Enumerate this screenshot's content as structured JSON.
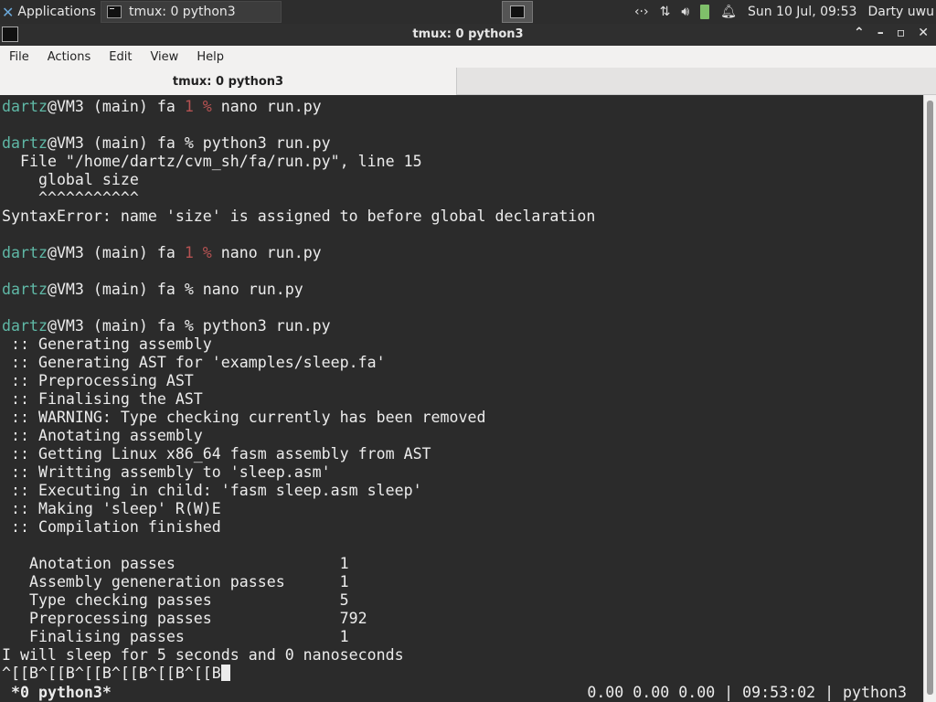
{
  "panel": {
    "applications_label": "Applications",
    "task_title": "tmux: 0 python3",
    "datetime": "Sun 10 Jul, 09:53",
    "user": "Darty uwu",
    "tray_icons": [
      "network-arrows-icon",
      "transfer-icon",
      "volume-icon",
      "battery-icon",
      "bell-icon"
    ]
  },
  "window": {
    "title": "tmux: 0 python3"
  },
  "menu": {
    "items": [
      "File",
      "Actions",
      "Edit",
      "View",
      "Help"
    ]
  },
  "tab": {
    "label": "tmux: 0 python3"
  },
  "terminal": {
    "user": "dartz",
    "lines": [
      {
        "type": "prompt",
        "host": "@VM3 (main) fa ",
        "status": "1",
        "sym": "% ",
        "cmd": "nano run.py"
      },
      {
        "type": "blank"
      },
      {
        "type": "prompt",
        "host": "@VM3 (main) fa ",
        "status": "",
        "sym": "% ",
        "cmd": "python3 run.py"
      },
      {
        "type": "text",
        "text": "  File \"/home/dartz/cvm_sh/fa/run.py\", line 15"
      },
      {
        "type": "text",
        "text": "    global size"
      },
      {
        "type": "text",
        "text": "    ^^^^^^^^^^^"
      },
      {
        "type": "text",
        "text": "SyntaxError: name 'size' is assigned to before global declaration"
      },
      {
        "type": "blank"
      },
      {
        "type": "prompt",
        "host": "@VM3 (main) fa ",
        "status": "1",
        "sym": "% ",
        "cmd": "nano run.py"
      },
      {
        "type": "blank"
      },
      {
        "type": "prompt",
        "host": "@VM3 (main) fa ",
        "status": "",
        "sym": "% ",
        "cmd": "nano run.py"
      },
      {
        "type": "blank"
      },
      {
        "type": "prompt",
        "host": "@VM3 (main) fa ",
        "status": "",
        "sym": "% ",
        "cmd": "python3 run.py"
      },
      {
        "type": "text",
        "text": " :: Generating assembly"
      },
      {
        "type": "text",
        "text": " :: Generating AST for 'examples/sleep.fa'"
      },
      {
        "type": "text",
        "text": " :: Preprocessing AST"
      },
      {
        "type": "text",
        "text": " :: Finalising the AST"
      },
      {
        "type": "text",
        "text": " :: WARNING: Type checking currently has been removed"
      },
      {
        "type": "text",
        "text": " :: Anotating assembly"
      },
      {
        "type": "text",
        "text": " :: Getting Linux x86_64 fasm assembly from AST"
      },
      {
        "type": "text",
        "text": " :: Writting assembly to 'sleep.asm'"
      },
      {
        "type": "text",
        "text": " :: Executing in child: 'fasm sleep.asm sleep'"
      },
      {
        "type": "text",
        "text": " :: Making 'sleep' R(W)E"
      },
      {
        "type": "text",
        "text": " :: Compilation finished"
      },
      {
        "type": "blank"
      },
      {
        "type": "text",
        "text": "   Anotation passes                  1"
      },
      {
        "type": "text",
        "text": "   Assembly geneneration passes      1"
      },
      {
        "type": "text",
        "text": "   Type checking passes              5"
      },
      {
        "type": "text",
        "text": "   Preprocessing passes              792"
      },
      {
        "type": "text",
        "text": "   Finalising passes                 1"
      },
      {
        "type": "text",
        "text": "I will sleep for 5 seconds and 0 nanoseconds"
      },
      {
        "type": "cursorline",
        "text": "^[[B^[[B^[[B^[[B^[[B^[[B"
      }
    ]
  },
  "tmux_status": {
    "left": " *0 python3*",
    "right": "0.00 0.00 0.00 | 09:53:02 | python3"
  }
}
